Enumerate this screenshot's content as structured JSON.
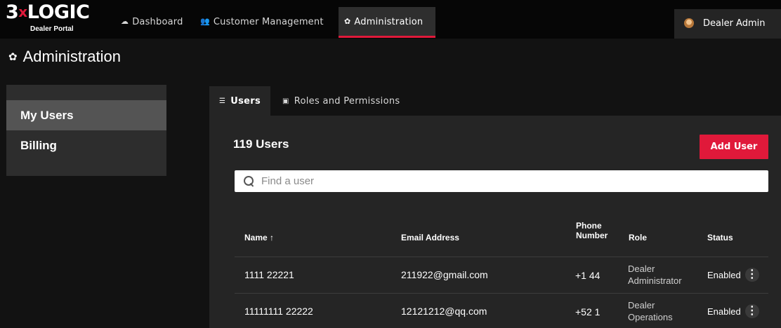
{
  "brand": {
    "name_left": "3",
    "name_x": "x",
    "name_right": "LOGIC",
    "subtitle": "Dealer Portal"
  },
  "nav": {
    "items": [
      {
        "label": "Dashboard",
        "icon": "cloud-icon"
      },
      {
        "label": "Customer Management",
        "icon": "users-icon"
      },
      {
        "label": "Administration",
        "icon": "gear-icon",
        "active": true
      }
    ],
    "user_label": "Dealer Admin"
  },
  "page": {
    "title": "Administration"
  },
  "sidebar": {
    "items": [
      {
        "label": "My Users",
        "active": true
      },
      {
        "label": "Billing"
      }
    ]
  },
  "tabs": [
    {
      "label": "Users",
      "active": true
    },
    {
      "label": "Roles and Permissions"
    }
  ],
  "users": {
    "count_label": "119 Users",
    "add_button": "Add User",
    "search_placeholder": "Find a user"
  },
  "table": {
    "headers": {
      "name": "Name ↑",
      "email": "Email Address",
      "phone_line1": "Phone",
      "phone_line2": "Number",
      "role": "Role",
      "status": "Status"
    },
    "rows": [
      {
        "name": "1111 22221",
        "email": "211922@gmail.com",
        "phone": "+1 44",
        "role_line1": "Dealer",
        "role_line2": "Administrator",
        "status": "Enabled"
      },
      {
        "name": "11111111 22222",
        "email": "12121212@qq.com",
        "phone": "+52 1",
        "role_line1": "Dealer",
        "role_line2": "Operations",
        "status": "Enabled"
      }
    ]
  },
  "colors": {
    "accent": "#e0193a",
    "background": "#121212",
    "panel": "#252525"
  }
}
